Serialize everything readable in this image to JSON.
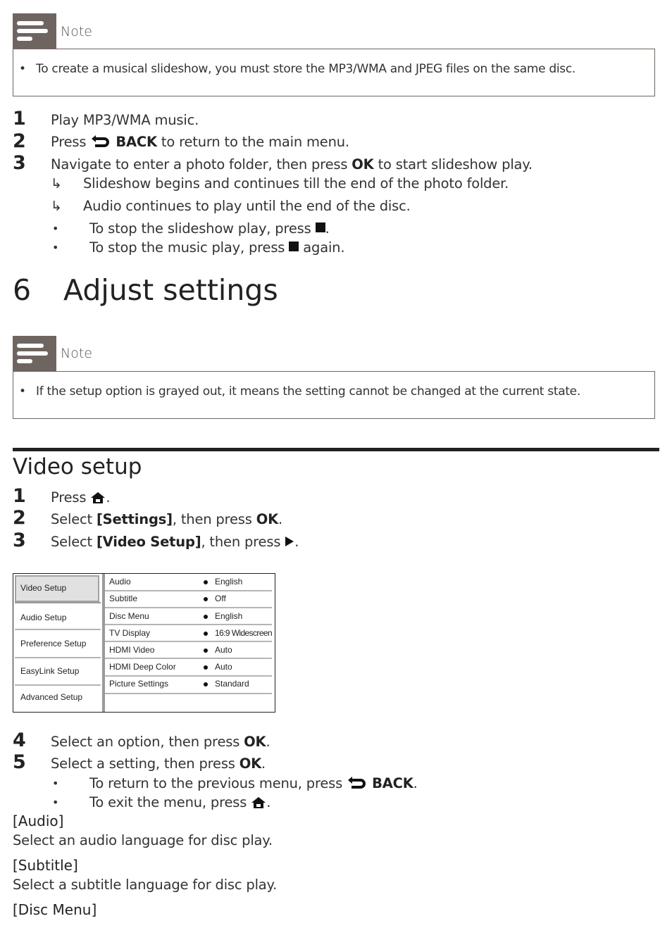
{
  "note1": {
    "title": "Note",
    "text": "To create a musical slideshow, you must store the MP3/WMA and JPEG files on the same disc."
  },
  "steps_a": [
    {
      "num": "1",
      "text": "Play MP3/WMA music."
    },
    {
      "num": "2",
      "pre": "Press",
      "key": "BACK",
      "post": "to return to the main menu."
    },
    {
      "num": "3",
      "pre": "Navigate to enter a photo folder, then press",
      "key": "OK",
      "post": "to start slideshow play."
    }
  ],
  "results_a": [
    {
      "symbol": "↳",
      "text": "Slideshow begins and continues till the end of the photo folder."
    },
    {
      "symbol": "↳",
      "text": "Audio continues to play until the end of the disc."
    }
  ],
  "bullets_a": [
    {
      "symbol": "•",
      "pre": "To stop the slideshow play, press",
      "post": "."
    },
    {
      "symbol": "•",
      "pre": "To stop the music play, press",
      "post": "again."
    }
  ],
  "chapter": {
    "number": "6",
    "title": "Adjust settings"
  },
  "note2": {
    "title": "Note",
    "text": "If the setup option is grayed out, it means the setting cannot be changed at the current state."
  },
  "section": {
    "title": "Video setup"
  },
  "steps_b": [
    {
      "num": "1",
      "pre": "Press",
      "post": "."
    },
    {
      "num": "2",
      "pre": "Select",
      "key1": "[Settings]",
      "mid": ", then press",
      "key2": "OK",
      "post": "."
    },
    {
      "num": "3",
      "pre": "Select",
      "key1": "[Video Setup]",
      "mid": ", then press",
      "post": "."
    }
  ],
  "menu": {
    "left_items": [
      "Video Setup",
      "Audio Setup",
      "Preference Setup",
      "EasyLink Setup",
      "Advanced Setup"
    ],
    "selected_index": 0,
    "rows": [
      {
        "label": "Audio",
        "value": "English"
      },
      {
        "label": "Subtitle",
        "value": "Off"
      },
      {
        "label": "Disc Menu",
        "value": "English"
      },
      {
        "label": "TV Display",
        "value": "16:9 Widescreen"
      },
      {
        "label": "HDMI Video",
        "value": "Auto"
      },
      {
        "label": "HDMI Deep Color",
        "value": "Auto"
      },
      {
        "label": "Picture Settings",
        "value": "Standard"
      }
    ]
  },
  "steps_c": [
    {
      "num": "4",
      "pre": "Select an option, then press",
      "key": "OK",
      "post": "."
    },
    {
      "num": "5",
      "pre": "Select a setting, then press",
      "key": "OK",
      "post": "."
    }
  ],
  "bullets_c": [
    {
      "symbol": "•",
      "pre": "To return to the previous menu, press",
      "key": "BACK",
      "post": "."
    },
    {
      "symbol": "•",
      "pre": "To exit the menu, press",
      "post": "."
    }
  ],
  "options": [
    {
      "title": "[Audio]",
      "desc": "Select an audio language for disc play."
    },
    {
      "title": "[Subtitle]",
      "desc": "Select a subtitle language for disc play."
    },
    {
      "title": "[Disc Menu]"
    }
  ],
  "colors": {
    "note_accent": "#6f6560",
    "text": "#222222"
  }
}
